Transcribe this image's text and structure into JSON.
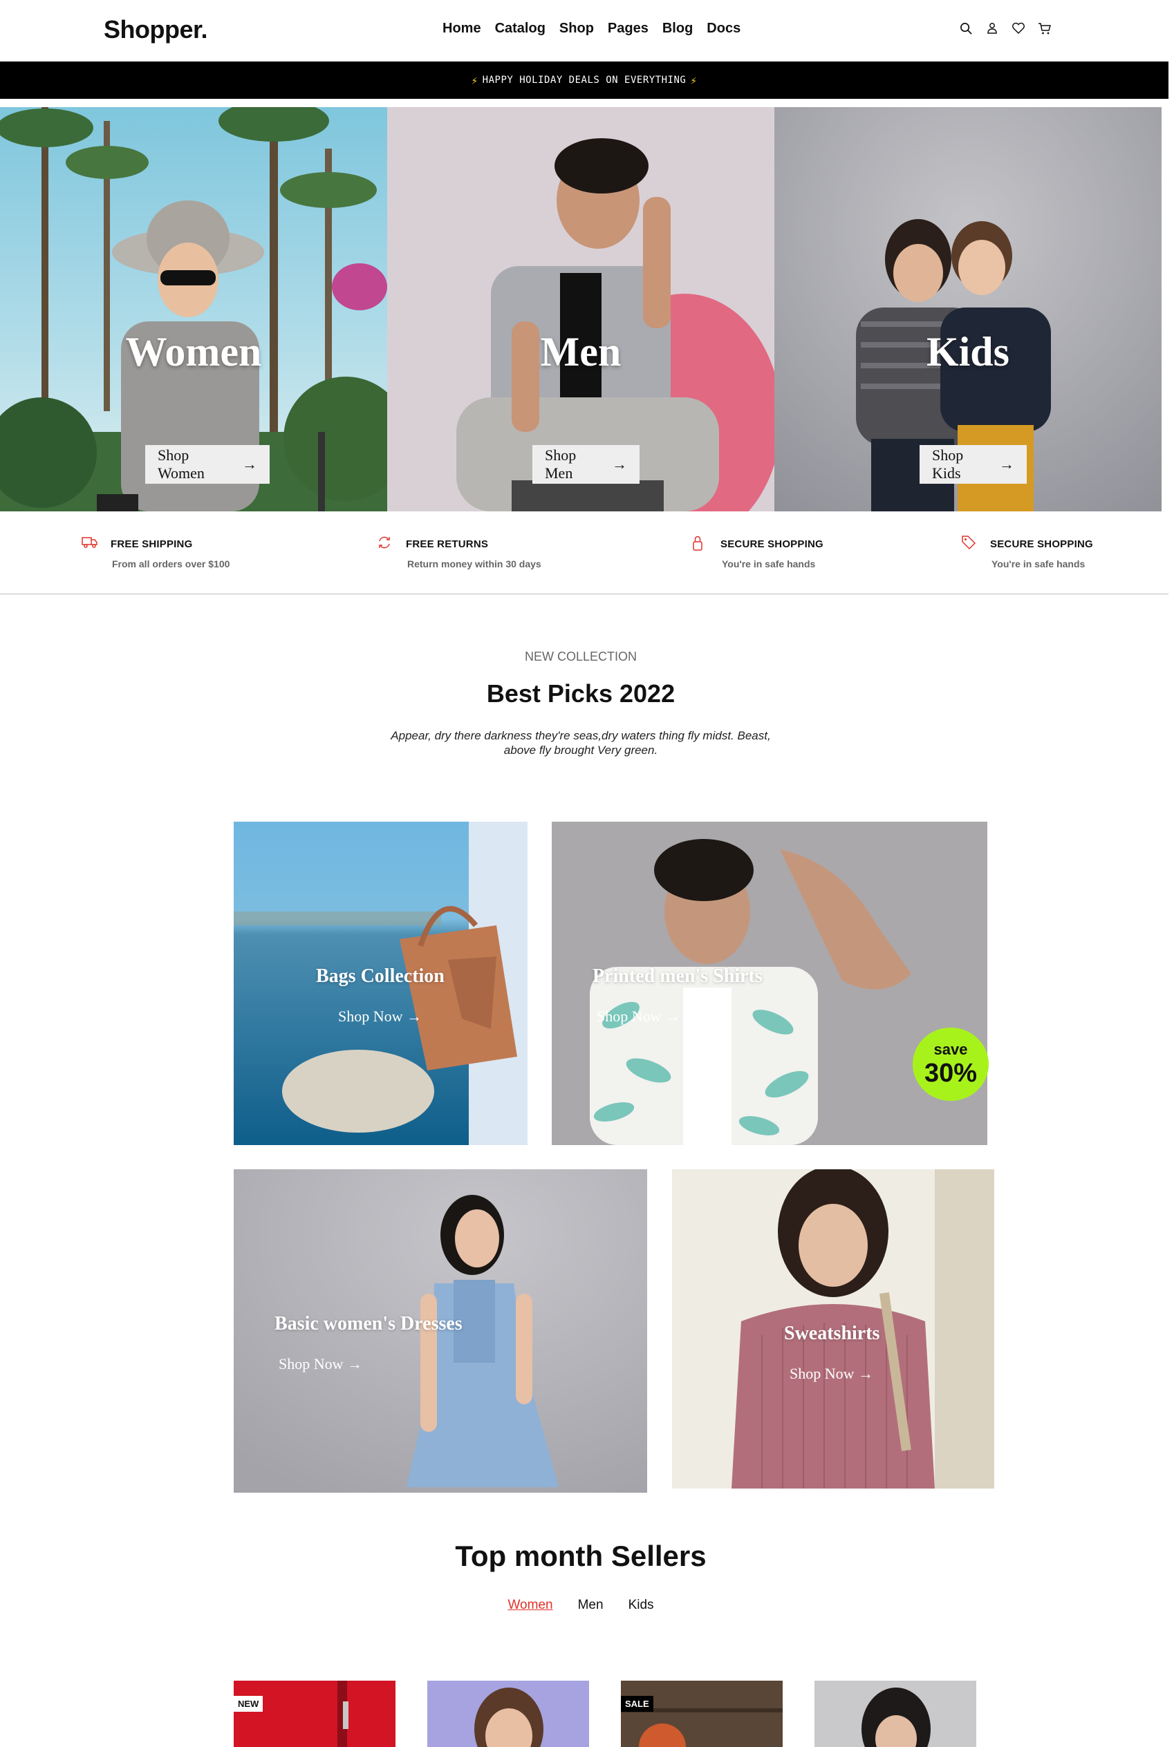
{
  "header": {
    "logo": "Shopper.",
    "nav": [
      "Home",
      "Catalog",
      "Shop",
      "Pages",
      "Blog",
      "Docs"
    ],
    "icons": [
      "search-icon",
      "user-icon",
      "heart-icon",
      "cart-icon"
    ]
  },
  "promo": {
    "text": "HAPPY HOLIDAY DEALS ON EVERYTHING"
  },
  "hero": [
    {
      "title": "Women",
      "button": "Shop Women"
    },
    {
      "title": "Men",
      "button": "Shop Men"
    },
    {
      "title": "Kids",
      "button": "Shop Kids"
    }
  ],
  "features": [
    {
      "icon": "truck-icon",
      "title": "FREE SHIPPING",
      "subtitle": "From all orders over $100"
    },
    {
      "icon": "refresh-icon",
      "title": "FREE RETURNS",
      "subtitle": "Return money within 30 days"
    },
    {
      "icon": "lock-icon",
      "title": "SECURE SHOPPING",
      "subtitle": "You're in safe hands"
    },
    {
      "icon": "tag-icon",
      "title": "SECURE SHOPPING",
      "subtitle": "You're in safe hands"
    }
  ],
  "picks": {
    "eyebrow": "NEW COLLECTION",
    "title": "Best Picks 2022",
    "description_line1": "Appear, dry there darkness they're seas,dry waters thing fly midst. Beast,",
    "description_line2": "above fly brought Very green."
  },
  "collections": [
    {
      "title": "Bags Collection",
      "cta": "Shop Now"
    },
    {
      "title": "Printed men's Shirts",
      "cta": "Shop Now"
    },
    {
      "title": "Basic women's Dresses",
      "cta": "Shop Now"
    },
    {
      "title": "Sweatshirts",
      "cta": "Shop Now"
    }
  ],
  "save_badge": {
    "line1": "save",
    "line2": "30%"
  },
  "sellers": {
    "title": "Top month Sellers",
    "tabs": [
      "Women",
      "Men",
      "Kids"
    ],
    "active_tab": "Women",
    "product_tags": [
      "NEW",
      "",
      "SALE",
      ""
    ]
  },
  "colors": {
    "accent_red": "#e0322b",
    "badge_green": "#a8f21c",
    "promo_bg": "#000000"
  }
}
